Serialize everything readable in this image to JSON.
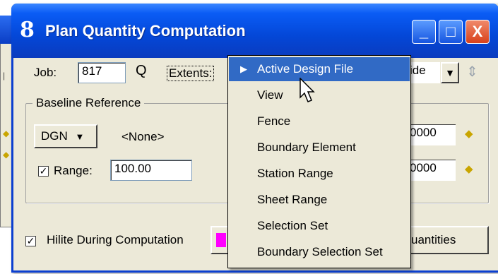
{
  "window": {
    "title": "Plan Quantity Computation",
    "app_icon_glyph": "8",
    "minimize_glyph": "_",
    "maximize_glyph": "□",
    "close_glyph": "X"
  },
  "job": {
    "label": "Job:",
    "value": "817",
    "search_icon_glyph": "Q"
  },
  "extents": {
    "label": "Extents:",
    "right_combo_partial": "ide",
    "dropdown_arrow": "▼",
    "options": [
      {
        "label": "Active Design File",
        "selected": true
      },
      {
        "label": "View",
        "selected": false
      },
      {
        "label": "Fence",
        "selected": false
      },
      {
        "label": "Boundary Element",
        "selected": false
      },
      {
        "label": "Station Range",
        "selected": false
      },
      {
        "label": "Sheet Range",
        "selected": false
      },
      {
        "label": "Selection Set",
        "selected": false
      },
      {
        "label": "Boundary Selection Set",
        "selected": false
      }
    ]
  },
  "baseline": {
    "group_label": "Baseline Reference",
    "source_value": "DGN",
    "source_arrow": "▼",
    "reference_value": "<None>",
    "range_label": "Range:",
    "range_checked": true,
    "range_value": "100.00",
    "right_value_1": "0000",
    "right_value_2": "0000"
  },
  "hilite": {
    "label": "Hilite During Computation",
    "checked": true,
    "color": "#ff00ff"
  },
  "actions": {
    "quantities_partial": "uantities"
  },
  "icons": {
    "target": "target-icon",
    "search": "search-icon",
    "locate": "locate-element-icon"
  },
  "colors": {
    "title_bar": "#0447d7",
    "menu_highlight": "#316ac5",
    "close_button": "#d8411b",
    "dialog_bg": "#ece9d8"
  }
}
